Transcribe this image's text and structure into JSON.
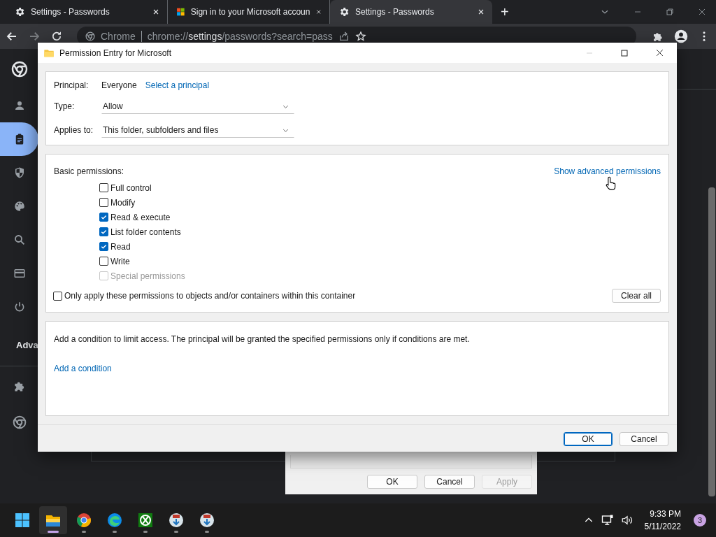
{
  "browser": {
    "tabs": [
      {
        "title": "Settings - Passwords",
        "selected": false,
        "kind": "gear"
      },
      {
        "title": "Sign in to your Microsoft accoun",
        "selected": false,
        "kind": "microsoft"
      },
      {
        "title": "Settings - Passwords",
        "selected": true,
        "kind": "gear"
      }
    ],
    "new_tab": "+",
    "address": {
      "site": "Chrome",
      "scheme": "chrome://",
      "host": "settings",
      "path": "/passwords?search=pass"
    }
  },
  "settings_nav": {
    "items": [
      {
        "selected": false
      },
      {
        "selected": true
      },
      {
        "selected": false
      },
      {
        "selected": false
      },
      {
        "selected": false
      },
      {
        "selected": false
      },
      {
        "selected": false
      }
    ],
    "advanced_label": "Adva",
    "extra_items": [
      {
        "selected": false
      },
      {
        "selected": false
      }
    ]
  },
  "dialog": {
    "title": "Permission Entry for Microsoft",
    "principal_label": "Principal:",
    "principal": "Everyone",
    "select_principal": "Select a principal",
    "type_label": "Type:",
    "type_value": "Allow",
    "applies_label": "Applies to:",
    "applies_value": "This folder, subfolders and files",
    "basic_label": "Basic permissions:",
    "advanced_link": "Show advanced permissions",
    "permissions": [
      {
        "label": "Full control",
        "checked": false,
        "disabled": false
      },
      {
        "label": "Modify",
        "checked": false,
        "disabled": false
      },
      {
        "label": "Read & execute",
        "checked": true,
        "disabled": false
      },
      {
        "label": "List folder contents",
        "checked": true,
        "disabled": false
      },
      {
        "label": "Read",
        "checked": true,
        "disabled": false
      },
      {
        "label": "Write",
        "checked": false,
        "disabled": false
      },
      {
        "label": "Special permissions",
        "checked": false,
        "disabled": true
      }
    ],
    "only_apply": {
      "label": "Only apply these permissions to objects and/or containers within this container",
      "checked": false
    },
    "clear_all": "Clear all",
    "condition_text": "Add a condition to limit access. The principal will be granted the specified permissions only if conditions are met.",
    "add_condition": "Add a condition",
    "buttons": [
      {
        "label": "OK",
        "default": true
      },
      {
        "label": "Cancel",
        "default": false
      }
    ]
  },
  "background_dialog": {
    "buttons": [
      {
        "label": "OK",
        "disabled": false
      },
      {
        "label": "Cancel",
        "disabled": false
      },
      {
        "label": "Apply",
        "disabled": true
      }
    ]
  },
  "taskbar": {
    "apps": [
      {
        "running": false,
        "active": false
      },
      {
        "running": true,
        "active": true
      },
      {
        "running": true,
        "active": false
      },
      {
        "running": true,
        "active": false
      },
      {
        "running": true,
        "active": false
      },
      {
        "running": true,
        "active": false
      },
      {
        "running": true,
        "active": false
      }
    ],
    "time": "9:33 PM",
    "date": "5/11/2022",
    "notifications": "3"
  }
}
